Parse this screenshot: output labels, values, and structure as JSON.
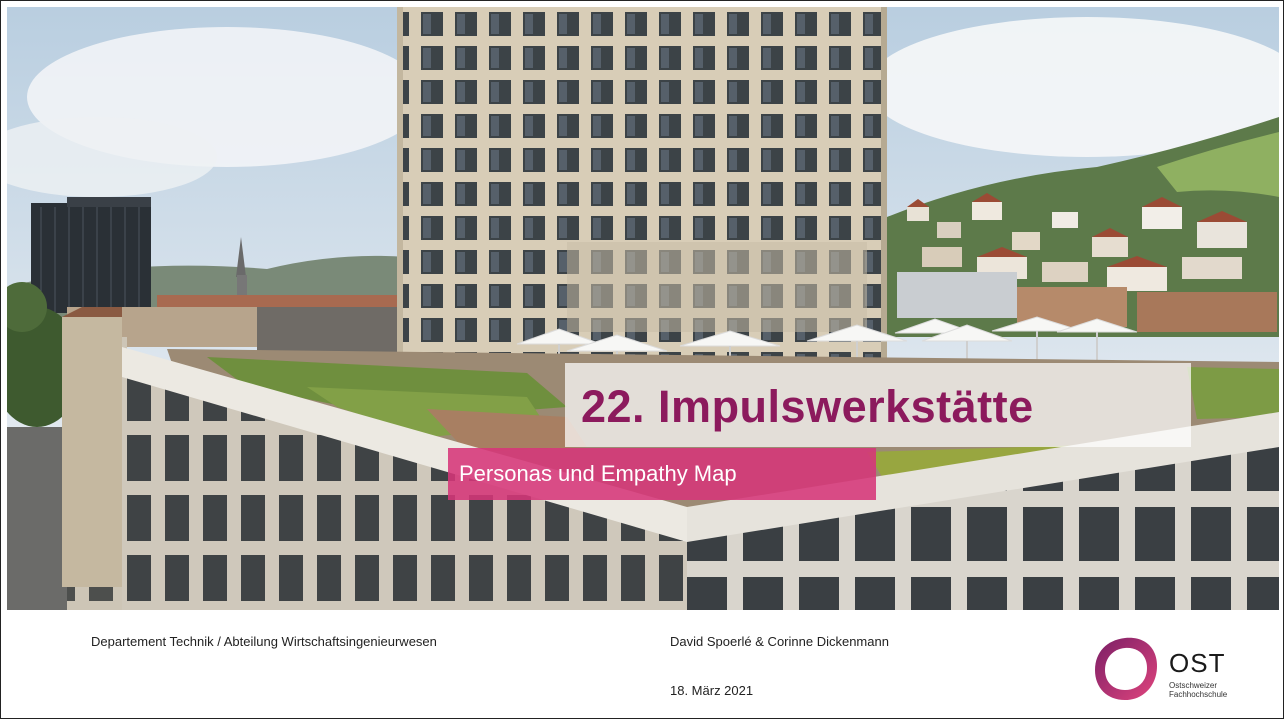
{
  "slide": {
    "title": "22. Impulswerkstätte",
    "subtitle": "Personas und Empathy Map"
  },
  "footer": {
    "department": "Departement Technik / Abteilung Wirtschaftsingenieurwesen",
    "authors": "David Spoerlé & Corinne Dickenmann",
    "date": "18. März 2021"
  },
  "logo": {
    "name": "OST",
    "line1": "Ostschweizer",
    "line2": "Fachhochschule"
  },
  "colors": {
    "title": "#8c1a5d",
    "subtitle_bg": "#d63579",
    "logo_ring_dark": "#7a1f66",
    "logo_ring_light": "#e0447d"
  }
}
